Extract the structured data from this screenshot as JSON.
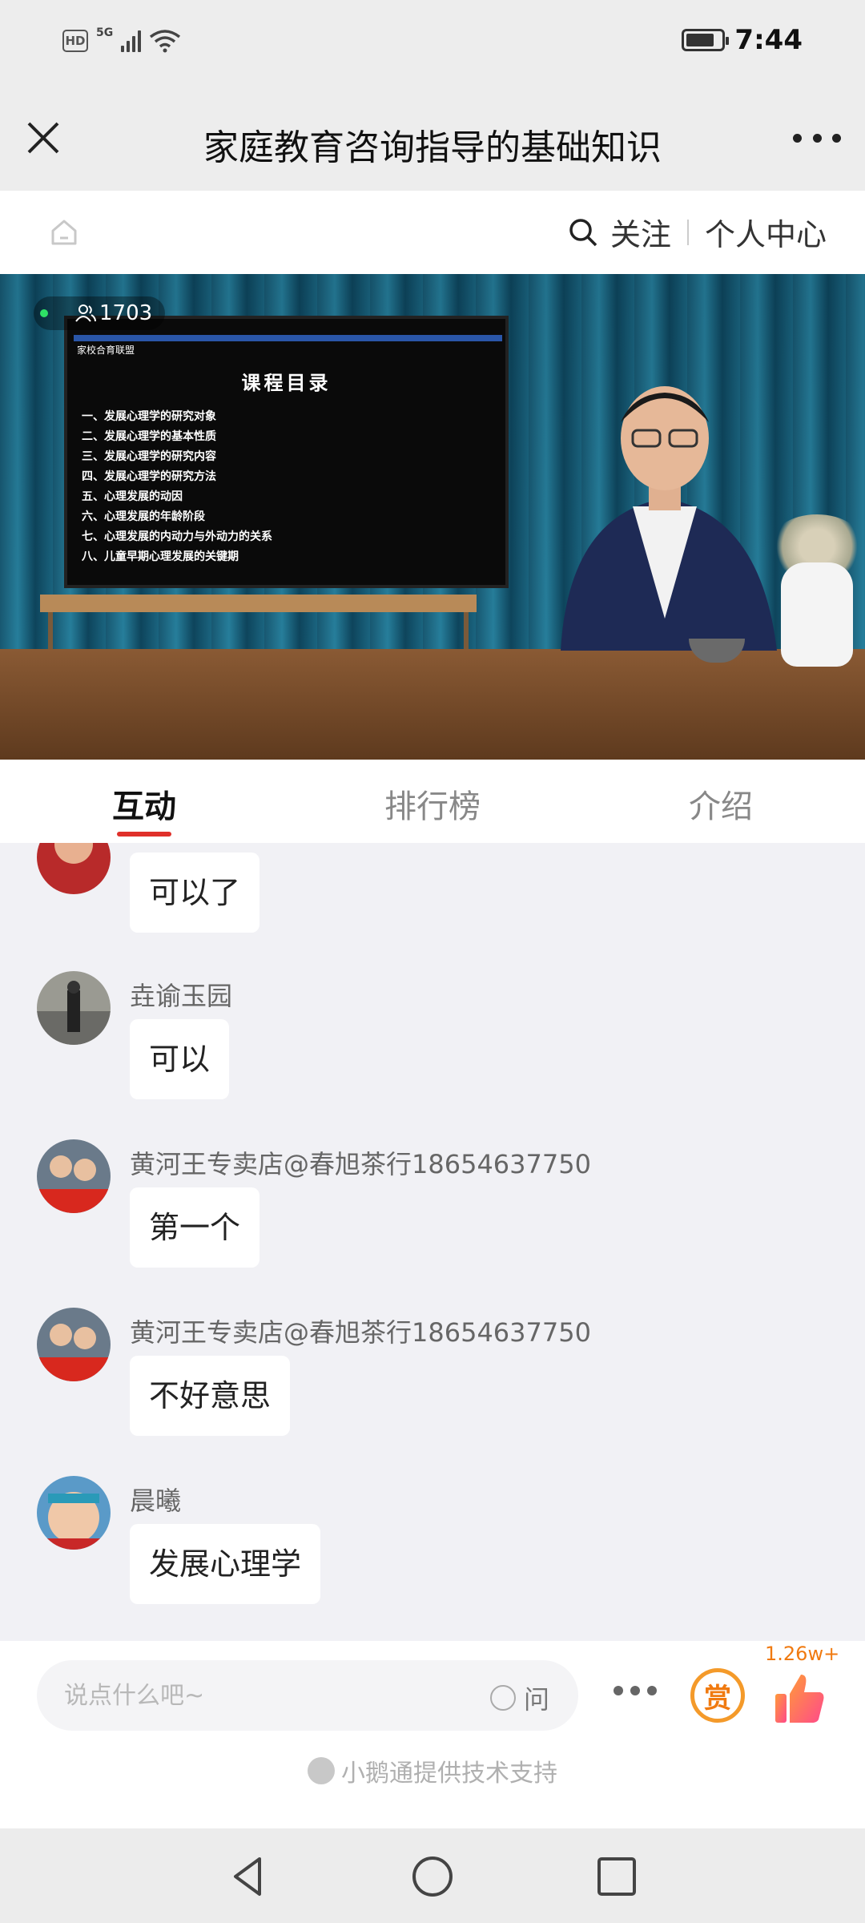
{
  "status_bar": {
    "hd": "HD",
    "network": "5G",
    "time": "7:44",
    "battery_level": 0.8
  },
  "header": {
    "title": "家庭教育咨询指导的基础知识"
  },
  "nav": {
    "follow_label": "关注",
    "profile_label": "个人中心"
  },
  "video": {
    "viewer_count": "1703",
    "screen_brand": "家校合育联盟",
    "screen_title": "课程目录",
    "screen_items": [
      "一、发展心理学的研究对象",
      "二、发展心理学的基本性质",
      "三、发展心理学的研究内容",
      "四、发展心理学的研究方法",
      "五、心理发展的动因",
      "六、心理发展的年龄阶段",
      "七、心理发展的内动力与外动力的关系",
      "八、儿童早期心理发展的关键期"
    ]
  },
  "tabs": [
    {
      "label": "互动",
      "active": true
    },
    {
      "label": "排行榜",
      "active": false
    },
    {
      "label": "介绍",
      "active": false
    }
  ],
  "messages": [
    {
      "name": "",
      "text": "可以了"
    },
    {
      "name": "垚谕玉园",
      "text": "可以"
    },
    {
      "name": "黄河王专卖店@春旭茶行18654637750",
      "text": "第一个"
    },
    {
      "name": "黄河王专卖店@春旭茶行18654637750",
      "text": "不好意思"
    },
    {
      "name": "晨曦",
      "text": "发展心理学"
    }
  ],
  "input": {
    "placeholder": "说点什么吧~",
    "ask_label": "问",
    "reward_label": "赏",
    "like_count": "1.26w+",
    "powered_by": "小鹅通提供技术支持"
  },
  "colors": {
    "accent": "#e0302a",
    "reward": "#f07a10",
    "chat_bg": "#f1f1f5"
  }
}
